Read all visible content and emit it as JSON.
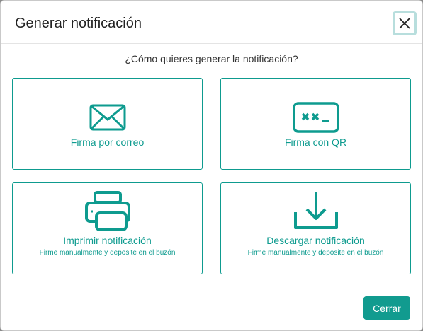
{
  "dialog": {
    "title": "Generar notificación",
    "question": "¿Cómo quieres generar la notificación?"
  },
  "options": {
    "email": {
      "label": "Firma por correo",
      "icon": "envelope-icon"
    },
    "qr": {
      "label": "Firma con QR",
      "icon": "qr-code-icon"
    },
    "print": {
      "label": "Imprimir notificación",
      "sublabel": "Firme manualmente y deposite en el buzón",
      "icon": "printer-icon"
    },
    "download": {
      "label": "Descargar notificación",
      "sublabel": "Firme manualmente y deposite en el buzón",
      "icon": "download-icon"
    }
  },
  "footer": {
    "close_label": "Cerrar"
  },
  "colors": {
    "accent": "#119b8f",
    "text": "#222222"
  }
}
